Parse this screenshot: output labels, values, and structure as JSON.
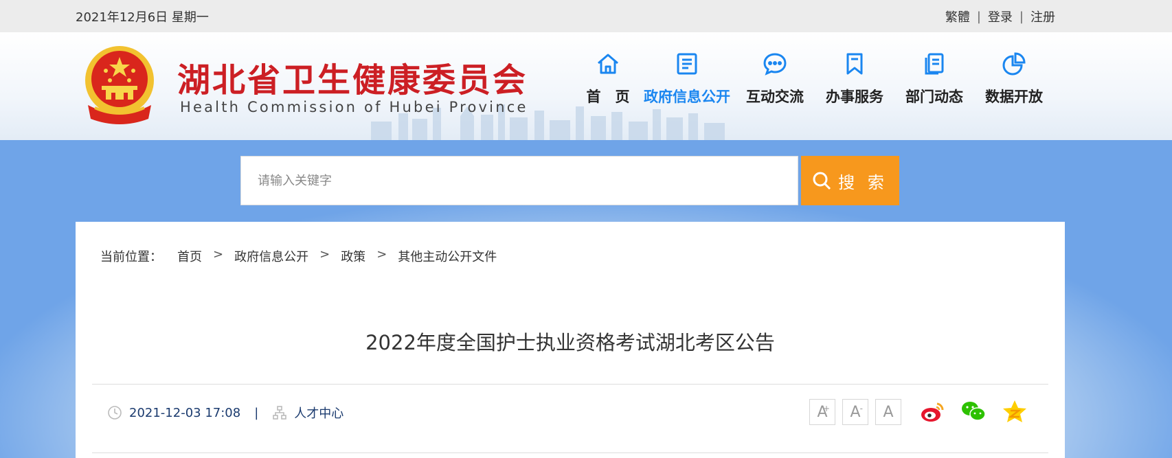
{
  "topbar": {
    "date": "2021年12月6日 星期一",
    "links": [
      "繁體",
      "登录",
      "注册"
    ],
    "separator": "|"
  },
  "brand": {
    "name_cn": "湖北省卫生健康委员会",
    "name_en": "Health Commission of Hubei Province",
    "color": "#cc1f24"
  },
  "nav": {
    "items": [
      {
        "label": "首　页",
        "icon": "home-icon"
      },
      {
        "label": "政府信息公开",
        "icon": "document-icon",
        "active": true
      },
      {
        "label": "互动交流",
        "icon": "chat-icon"
      },
      {
        "label": "办事服务",
        "icon": "bookmark-icon"
      },
      {
        "label": "部门动态",
        "icon": "pages-icon"
      },
      {
        "label": "数据开放",
        "icon": "pie-chart-icon"
      }
    ],
    "active_color": "#1a86f0"
  },
  "search": {
    "placeholder": "请输入关键字",
    "button_label": "搜 索",
    "button_color": "#f7981d"
  },
  "breadcrumb": {
    "prefix": "当前位置：",
    "items": [
      "首页",
      "政府信息公开",
      "政策",
      "其他主动公开文件"
    ],
    "separator": ">"
  },
  "article": {
    "title": "2022年度全国护士执业资格考试湖北考区公告",
    "datetime": "2021-12-03 17:08",
    "source": "人才中心",
    "meta_separator": "|"
  },
  "tools": {
    "font_increase": "A",
    "font_decrease": "A",
    "font_reset": "A",
    "plus_mark": "+",
    "minus_mark": "-"
  },
  "share": [
    "weibo-icon",
    "wechat-icon",
    "qzone-icon"
  ]
}
